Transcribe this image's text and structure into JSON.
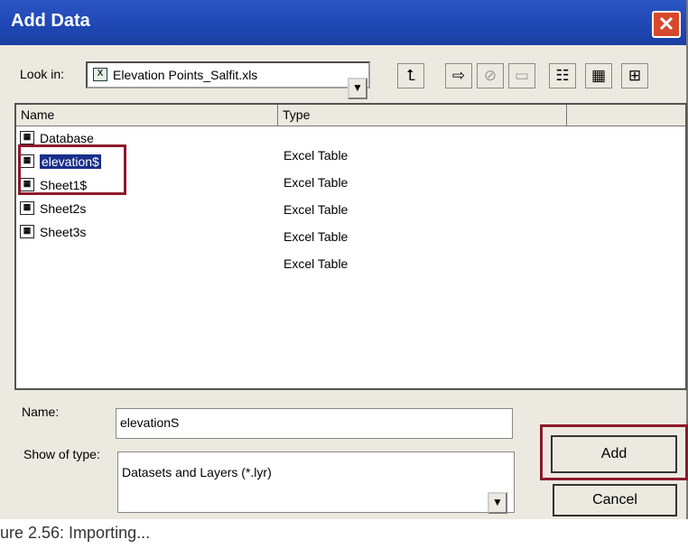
{
  "window": {
    "title": "Add Data",
    "close_glyph": "✕"
  },
  "lookin": {
    "label": "Look in:",
    "value": "Elevation Points_Salfit.xls",
    "icon": "excel-workbook-icon"
  },
  "toolbar": {
    "buttons": [
      {
        "name": "up-one-level-button",
        "glyph": "⮤"
      },
      {
        "name": "connect-folder-button",
        "glyph": "⇨"
      },
      {
        "name": "disconnect-folder-button",
        "glyph": "⊘"
      },
      {
        "name": "new-folder-button",
        "glyph": "▭"
      },
      {
        "name": "list-view-button",
        "glyph": "☷"
      },
      {
        "name": "details-view-button",
        "glyph": "▦"
      },
      {
        "name": "thumbnails-view-button",
        "glyph": "⊞"
      }
    ]
  },
  "list": {
    "headers": {
      "name": "Name",
      "type": "Type"
    },
    "items": [
      {
        "name": "Database",
        "type": "Excel Table"
      },
      {
        "name": "elevation$",
        "type": "Excel Table"
      },
      {
        "name": "Sheet1$",
        "type": "Excel Table"
      },
      {
        "name": "Sheet2s",
        "type": "Excel Table"
      },
      {
        "name": "Sheet3s",
        "type": "Excel Table"
      }
    ]
  },
  "name_field": {
    "label": "Name:",
    "value": "elevationS"
  },
  "type_field": {
    "label": "Show of type:",
    "value": "Datasets and Layers (*.lyr)"
  },
  "buttons": {
    "add": "Add",
    "cancel": "Cancel"
  },
  "caption": "ure 2.56: Importing..."
}
